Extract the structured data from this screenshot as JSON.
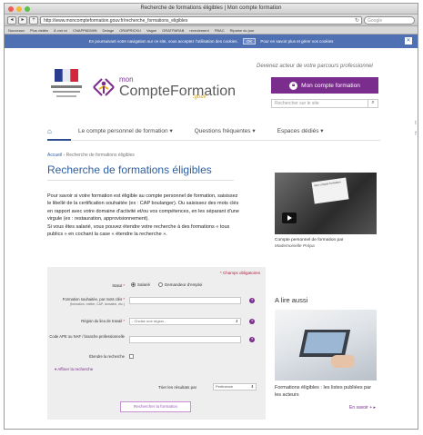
{
  "browser": {
    "window_title": "Recherche de formations éligibles | Mon compte formation",
    "url": "http://www.moncompteformation.gouv.fr/recherche_formations_eligibles",
    "search_placeholder": "Google",
    "nav_back": "◂",
    "nav_forward": "▸",
    "nav_add": "+",
    "reload": "↻",
    "bookmarks": [
      "Nouveaux",
      "Plus visités",
      "À voir ici",
      "CNAPPADMIN",
      "Delage",
      "ORAPRICKU",
      "Vague",
      "GRATPARAB",
      "recrutement",
      "PBAC",
      "Ripaine du jour"
    ]
  },
  "cookie_bar": {
    "text": "En poursuivant votre navigation sur ce site, vous acceptez l'utilisation des cookies.",
    "ok_label": "OK",
    "more_label": "Pour en savoir plus et gérer vos cookies",
    "close_label": "✕"
  },
  "header": {
    "republique_label": "RÉPUBLIQUE FRANÇAISE",
    "logo_mon": "mon",
    "logo_name": "CompteFormation",
    "logo_tag": ".gouv",
    "slogan": "Devenez acteur de votre parcours professionnel",
    "login_label": "Mon compte formation",
    "search_placeholder": "Rechercher sur le site",
    "search_icon": "magnifier-icon"
  },
  "social": {
    "twitter": "t",
    "facebook": "f"
  },
  "nav": {
    "home_icon": "house-icon",
    "items": [
      "Le compte personnel de formation",
      "Questions fréquentes",
      "Espaces dédiés"
    ]
  },
  "breadcrumb": {
    "home": "Accueil",
    "sep": " › ",
    "current": "Recherche de formations éligibles"
  },
  "page": {
    "title": "Recherche de formations éligibles",
    "intro_1": "Pour savoir si votre formation est éligible au compte personnel de formation, saisissez le libellé de la certification souhaitée (ex : CAP boulanger). Ou saisissez des mots clés en rapport avec votre domaine d'activité et/ou vos compétences, en les séparant d'une virgule (ex : restauration, approvisionnement).",
    "intro_2": "Si vous êtes salarié, vous pouvez étendre votre recherche à des formations « tous publics » en cochant la case « étendre la recherche »."
  },
  "form": {
    "required_note": "Champs obligatoires",
    "status_label": "Statut",
    "status_options": [
      "Salarié",
      "Demandeur d'emploi"
    ],
    "status_selected": "Salarié",
    "keywords_label": "Formation souhaitée, par mots clés",
    "keywords_sub": "(formation, métier, CAP, domaine, etc.)",
    "region_label": "Région du lieu de travail",
    "region_placeholder": "- Choisir une région -",
    "code_label": "Code APE ou NAF / branche professionnelle",
    "extend_label": "Étendre la recherche",
    "more_link": "Affiner la recherche",
    "sort_label": "Trier les résultats par",
    "sort_value": "Pertinence",
    "submit_label": "Rechercher la formation"
  },
  "sidebar": {
    "video_doc_title": "mon compte formation",
    "video_caption": "Compte personnel de formation par",
    "video_author": "Mademoiselle Prépa",
    "alire_title": "A lire aussi",
    "alire_caption": "Formations éligibles : les listes publiées par les acteurs",
    "alire_more": "En savoir +"
  }
}
